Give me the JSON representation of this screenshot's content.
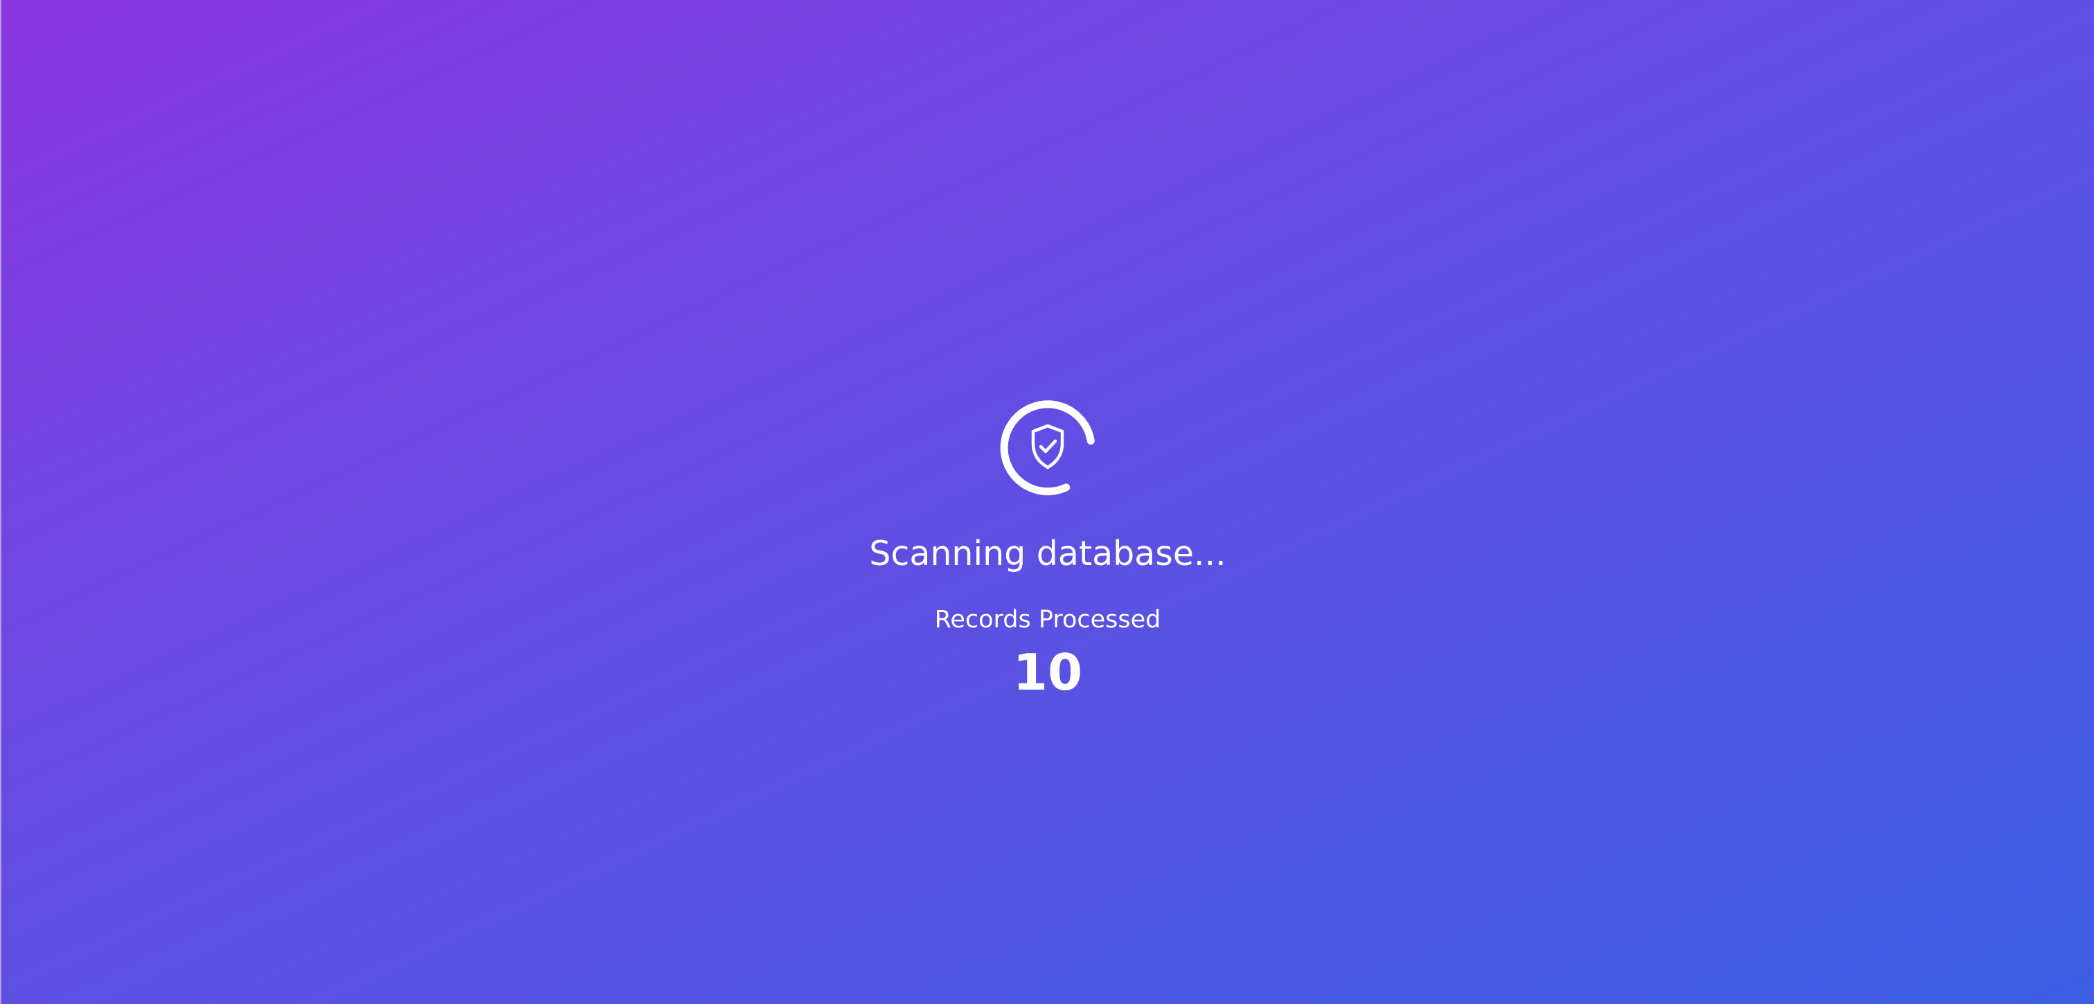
{
  "loader": {
    "icon": "shield-check-icon",
    "spinner": "circular-spinner",
    "status_text": "Scanning database...",
    "counter_label": "Records Processed",
    "counter_value": "10"
  },
  "colors": {
    "gradient_start": "#8a36e0",
    "gradient_end": "#3c5fe4",
    "foreground": "#ffffff"
  }
}
